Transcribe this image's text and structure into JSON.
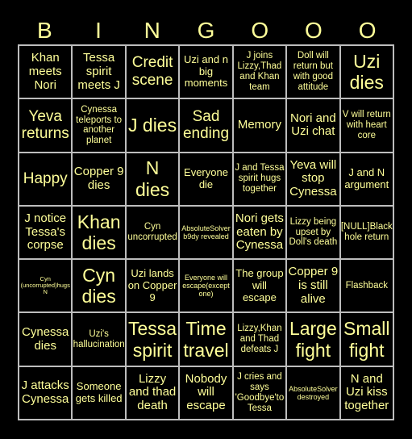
{
  "header": {
    "letters": [
      "B",
      "I",
      "N",
      "G",
      "O",
      "O",
      "O"
    ]
  },
  "colors": {
    "background": "#000000",
    "text": "#ffff99",
    "grid": "#bdbdbd"
  },
  "cells": [
    "Khan meets Nori",
    "Tessa spirit meets J",
    "Credit scene",
    "Uzi and n big moments",
    "J joins Lizzy,Thad and Khan team",
    "Doll will return but with good attitude",
    "Uzi dies",
    "Yeva returns",
    "Cynessa teleports to another planet",
    "J dies",
    "Sad ending",
    "Memory",
    "Nori and Uzi chat",
    "V will return with heart core",
    "Happy",
    "Copper 9 dies",
    "N dies",
    "Everyone die",
    "J and Tessa spirit hugs together",
    "Yeva will stop Cynessa",
    "J and N argument",
    "J notice Tessa's corpse",
    "Khan dies",
    "Cyn uncorrupted",
    "AbsoluteSolver b9dy revealed",
    "Nori gets eaten by Cynessa",
    "Lizzy being upset by Doll's death",
    "[NULL]Black hole return",
    "Cyn (uncorrupted)hugs N",
    "Cyn dies",
    "Uzi lands on Copper 9",
    "Everyone will escape(except one)",
    "The group will escape",
    "Copper 9 is still alive",
    "Flashback",
    "Cynessa dies",
    "Uzi's hallucination",
    "Tessa spirit",
    "Time travel",
    "Lizzy,Khan and Thad defeats J",
    "Large fight",
    "Small fight",
    "J attacks Cynessa",
    "Someone gets killed",
    "Lizzy and thad death",
    "Nobody will escape",
    "J cries and says 'Goodbye'to Tessa",
    "AbsoluteSolver destroyed",
    "N and Uzi kiss together"
  ]
}
